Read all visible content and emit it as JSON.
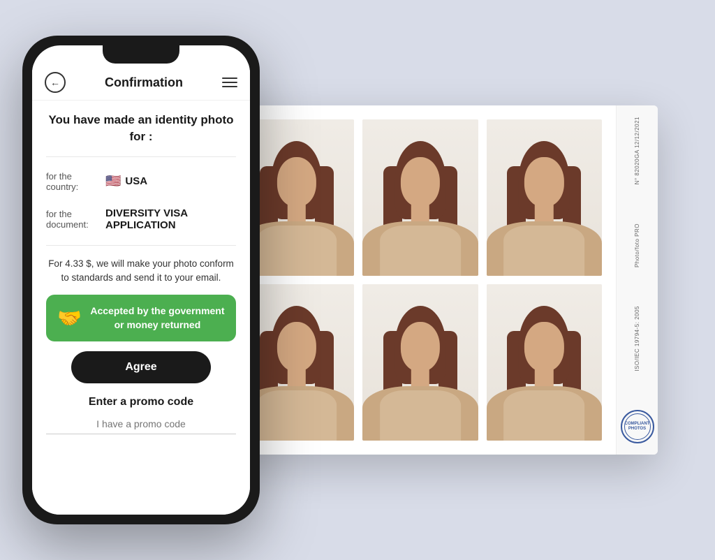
{
  "background_color": "#d8dce8",
  "phone": {
    "header": {
      "title": "Confirmation",
      "back_button_label": "←",
      "menu_label": "☰"
    },
    "content": {
      "intro_text": "You have made an identity photo for :",
      "country_label": "for the country:",
      "country_value": "USA",
      "country_flag": "🇺🇸",
      "document_label": "for the document:",
      "document_value": "DIVERSITY VISA APPLICATION",
      "price_text": "For 4.33 $, we will make your photo conform to standards and send it to your email.",
      "guarantee_text": "Accepted by the government or money returned",
      "guarantee_icon": "🤝",
      "agree_button_label": "Agree",
      "promo_title": "Enter a promo code",
      "promo_placeholder": "I have a promo code"
    }
  },
  "photo_sheet": {
    "sidebar": {
      "text_top": "N° 82020GA\n12/12/2021",
      "brand": "Photo/foto PRO",
      "standard": "ISO/IEC 19794-5: 2005",
      "stamp_text": "COMPLIANT\nPHOTOS"
    }
  },
  "colors": {
    "guarantee_bg": "#4caf50",
    "agree_btn_bg": "#1a1a1a",
    "phone_body": "#1a1a1a",
    "stamp_color": "#3a5a9f"
  }
}
